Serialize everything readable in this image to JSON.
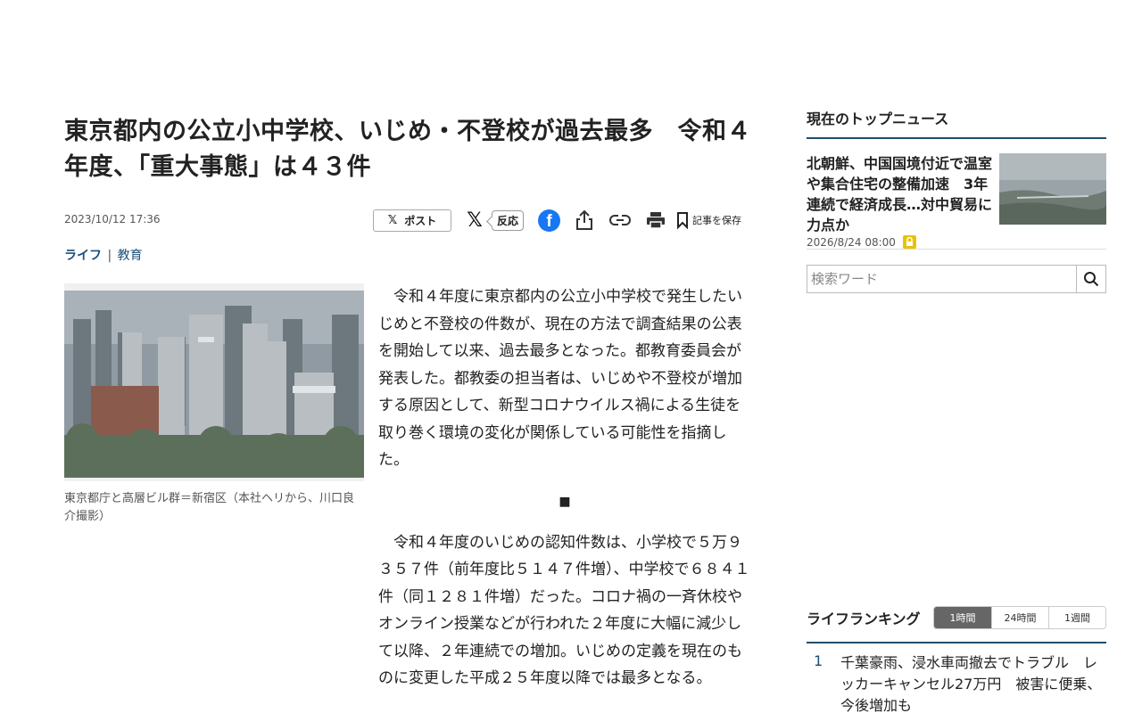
{
  "article": {
    "headline": "東京都内の公立小中学校、いじめ・不登校が過去最多　令和４年度、「重大事態」は４３件",
    "date": "2023/10/12 17:36",
    "share": {
      "post_label": "ポスト",
      "react_label": "反応",
      "save_label": "記事を保存"
    },
    "category": {
      "main": "ライフ",
      "separator": "|",
      "sub": "教育"
    },
    "photo_caption": "東京都庁と高層ビル群＝新宿区（本社ヘリから、川口良介撮影）",
    "paragraph1": "令和４年度に東京都内の公立小中学校で発生したいじめと不登校の件数が、現在の方法で調査結果の公表を開始して以来、過去最多となった。都教育委員会が発表した。都教委の担当者は、いじめや不登校が増加する原因として、新型コロナウイルス禍による生徒を取り巻く環境の変化が関係している可能性を指摘した。",
    "divider": "■",
    "paragraph2": "令和４年度のいじめの認知件数は、小学校で５万９３５７件（前年度比５１４７件増）、中学校で６８４１件（同１２８１件増）だった。コロナ禍の一斉休校やオンライン授業などが行われた２年度に大幅に減少して以降、２年連続での増加。いじめの定義を現在のものに変更した平成２５年度以降では最多となる。"
  },
  "sidebar": {
    "top_news_title": "現在のトップニュース",
    "top_news": {
      "title": "北朝鮮、中国国境付近で温室や集合住宅の整備加速　3年連続で経済成長…対中貿易に力点か",
      "date": "2026/8/24 08:00"
    },
    "search": {
      "placeholder": "検索ワード"
    },
    "ranking": {
      "title": "ライフランキング",
      "tabs": [
        "1時間",
        "24時間",
        "1週間"
      ],
      "items": [
        {
          "rank": "1",
          "title": "千葉豪雨、浸水車両撤去でトラブル　レッカーキャンセル27万円　被害に便乗、今後増加も"
        }
      ]
    }
  }
}
